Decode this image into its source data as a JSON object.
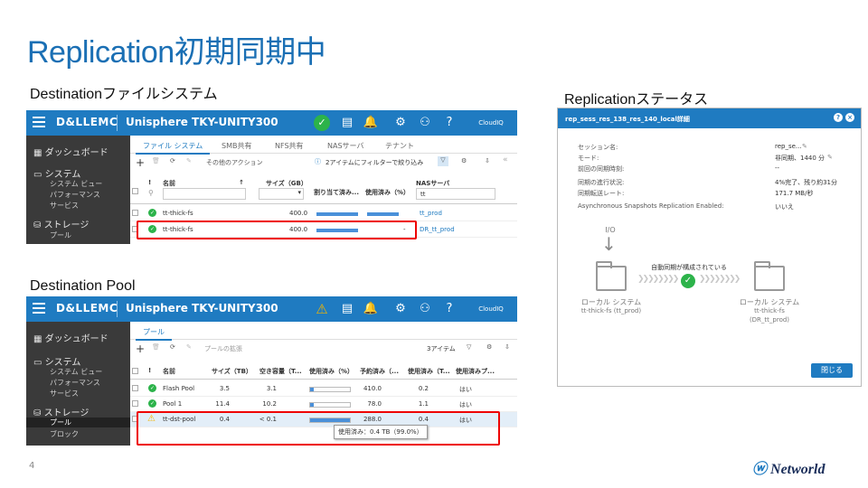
{
  "slide": {
    "title": "Replication初期同期中",
    "page_number": "4",
    "logo_text": "Networld"
  },
  "sections": {
    "dest_fs": "Destinationファイルシステム",
    "dest_pool": "Destination Pool",
    "rep_status": "Replicationステータス"
  },
  "unisphere": {
    "brand": "D&LLEMC",
    "product": "Unisphere TKY-UNITY300",
    "cloudiq": "CloudIQ"
  },
  "fs_pane": {
    "sidebar": {
      "dashboard": "ダッシュボード",
      "system": "システム",
      "system_view": "システム ビュー",
      "performance": "パフォーマンス",
      "service": "サービス",
      "storage": "ストレージ",
      "pool": "プール"
    },
    "tabs": [
      "ファイル システム",
      "SMB共有",
      "NFS共有",
      "NASサーバ",
      "テナント"
    ],
    "toolbar": {
      "more_actions": "その他のアクション",
      "filter_text": "2アイテムにフィルターで絞り込み"
    },
    "columns": {
      "alert": "!",
      "name": "名前",
      "size": "サイズ（GB）",
      "allocated": "割り当て済み...",
      "used": "使用済み（%）",
      "nas": "NASサーバ"
    },
    "nas_filter": "tt",
    "rows": [
      {
        "name": "tt-thick-fs",
        "size": "400.0",
        "used_text": "",
        "nas": "tt_prod",
        "allocated_pct": 0.95,
        "used_pct": 0.8
      },
      {
        "name": "tt-thick-fs",
        "size": "400.0",
        "used_text": "-",
        "nas": "DR_tt_prod",
        "allocated_pct": 0.95,
        "used_pct": 0.0
      }
    ]
  },
  "pool_pane": {
    "sidebar": {
      "dashboard": "ダッシュボード",
      "system": "システム",
      "system_view": "システム ビュー",
      "performance": "パフォーマンス",
      "service": "サービス",
      "storage": "ストレージ",
      "pool": "プール",
      "block": "ブロック"
    },
    "tabs": [
      "プール"
    ],
    "toolbar": {
      "expand": "プールの拡張",
      "count": "3アイテム"
    },
    "columns": {
      "alert": "!",
      "name": "名前",
      "size": "サイズ（TB）",
      "free": "空き容量（T...",
      "used_pct": "使用済み（%）",
      "reserved": "予約済み（...",
      "used_tb": "使用済み（T...",
      "used_pool": "使用済みプ..."
    },
    "rows": [
      {
        "name": "Flash Pool",
        "size": "3.5",
        "free": "3.1",
        "used_pct": 0.1,
        "reserved": "410.0",
        "used_tb": "0.2",
        "flag": "はい",
        "status": "ok"
      },
      {
        "name": "Pool 1",
        "size": "11.4",
        "free": "10.2",
        "used_pct": 0.1,
        "reserved": "78.0",
        "used_tb": "1.1",
        "flag": "はい",
        "status": "ok"
      },
      {
        "name": "tt-dst-pool",
        "size": "0.4",
        "free": "< 0.1",
        "used_pct": 0.99,
        "reserved": "288.0",
        "used_tb": "0.4",
        "flag": "はい",
        "status": "warn"
      }
    ],
    "tooltip": "使用済み：0.4 TB（99.0%）"
  },
  "dialog": {
    "title": "rep_sess_res_138_res_140_local詳細",
    "fields": [
      {
        "label": "セッション名:",
        "value": "rep_se..."
      },
      {
        "label": "モード:",
        "value": "非同期、1440 分"
      },
      {
        "label": "前回の同期時刻:",
        "value": "--"
      },
      {
        "label": "同期の進行状況:",
        "value": "4%完了、残り約31分"
      },
      {
        "label": "同期転送レート:",
        "value": "171.7 MB/秒"
      },
      {
        "label": "Asynchronous Snapshots Replication Enabled:",
        "value": "いいえ"
      }
    ],
    "io_label": "I/O",
    "sync_text": "自動同期が構成されている",
    "source": {
      "title": "ローカル システム",
      "sub": "tt-thick-fs (tt_prod)"
    },
    "target": {
      "title": "ローカル システム",
      "sub1": "tt-thick-fs",
      "sub2": "(DR_tt_prod)"
    },
    "close_button": "閉じる"
  },
  "colors": {
    "accent": "#1f7bc1",
    "title": "#1a6fb4",
    "ok": "#2cb34a",
    "warning": "#f1b400",
    "highlight": "#e00000"
  }
}
